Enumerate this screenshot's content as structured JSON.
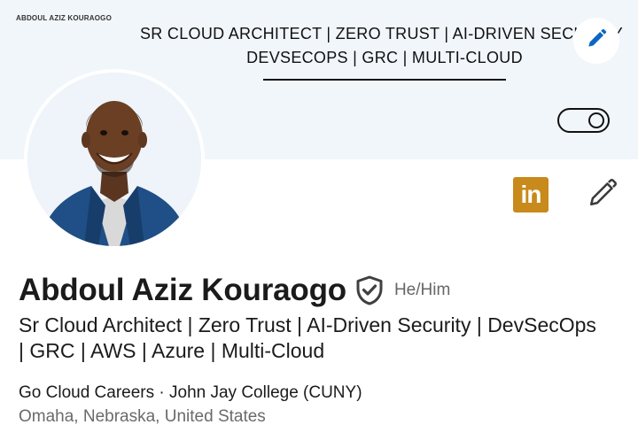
{
  "banner": {
    "small_text": "ABDOUL AZIZ KOURAOGO",
    "line1": "SR CLOUD ARCHITECT | ZERO TRUST | AI-DRIVEN SECURITY",
    "line2": "DEVSECOPS | GRC | MULTI-CLOUD",
    "edit_icon": "pencil-icon",
    "toggle_icon": "toggle-icon"
  },
  "profile": {
    "name": "Abdoul Aziz Kouraogo",
    "pronouns": "He/Him",
    "verified_icon": "verified-shield-icon",
    "headline": "Sr Cloud Architect | Zero Trust | AI-Driven Security | DevSecOps | GRC | AWS | Azure | Multi-Cloud",
    "company_line": "Go Cloud Careers · John Jay College (CUNY)",
    "location": "Omaha, Nebraska, United States"
  },
  "actions": {
    "linkedin_badge_text": "in",
    "linkedin_icon": "linkedin-icon",
    "edit_icon": "pencil-icon"
  },
  "colors": {
    "banner_bg": "#f1f6fb",
    "edit_blue": "#0a66c2",
    "linkedin_gold": "#c88a1b"
  }
}
